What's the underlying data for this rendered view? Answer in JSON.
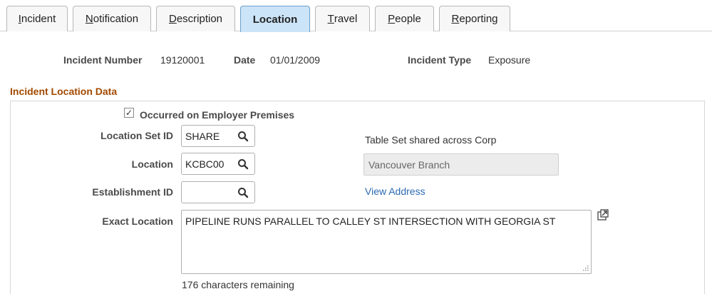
{
  "tabs": [
    {
      "pre": "",
      "ul": "I",
      "post": "ncident"
    },
    {
      "pre": "",
      "ul": "N",
      "post": "otification"
    },
    {
      "pre": "",
      "ul": "D",
      "post": "escription"
    },
    {
      "pre": "",
      "ul": "",
      "post": "Location"
    },
    {
      "pre": "",
      "ul": "T",
      "post": "ravel"
    },
    {
      "pre": "",
      "ul": "P",
      "post": "eople"
    },
    {
      "pre": "",
      "ul": "R",
      "post": "eporting"
    }
  ],
  "header": {
    "incident_number_label": "Incident Number",
    "incident_number": "19120001",
    "date_label": "Date",
    "date": "01/01/2009",
    "incident_type_label": "Incident Type",
    "incident_type": "Exposure"
  },
  "section": {
    "title": "Incident Location Data",
    "occurred_label": "Occurred on Employer Premises",
    "occurred_checked": true,
    "checkmark": "✓",
    "location_set_id_label": "Location Set ID",
    "location_set_id": "SHARE",
    "table_set_note": "Table Set shared across Corp",
    "location_label": "Location",
    "location": "KCBC00",
    "location_name": "Vancouver Branch",
    "establishment_id_label": "Establishment ID",
    "establishment_id": "",
    "view_address": "View Address",
    "exact_location_label": "Exact Location",
    "exact_location": "PIPELINE RUNS PARALLEL TO CALLEY ST INTERSECTION WITH GEORGIA ST",
    "chars_remaining": "176 characters remaining"
  },
  "colors": {
    "active_tab": "#cce4f7",
    "section_title": "#a34a00",
    "link": "#2a6ab1"
  }
}
